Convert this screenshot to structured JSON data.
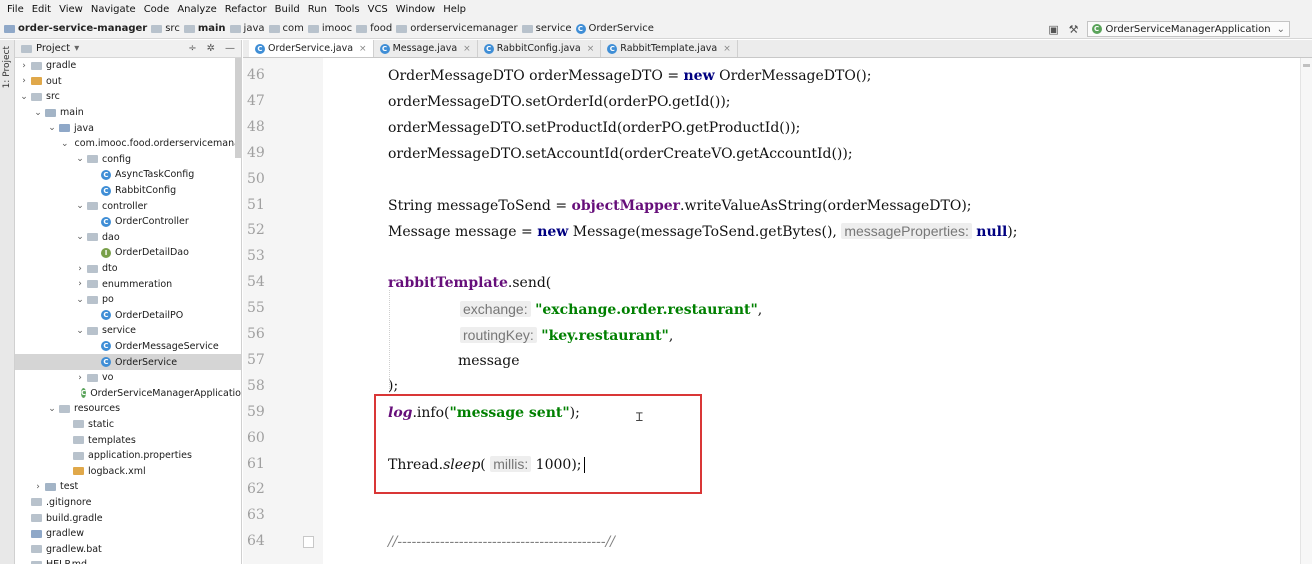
{
  "menu": [
    "File",
    "Edit",
    "View",
    "Navigate",
    "Code",
    "Analyze",
    "Refactor",
    "Build",
    "Run",
    "Tools",
    "VCS",
    "Window",
    "Help"
  ],
  "breadcrumbs": [
    "order-service-manager",
    "src",
    "main",
    "java",
    "com",
    "imooc",
    "food",
    "orderservicemanager",
    "service",
    "OrderService"
  ],
  "run_config": "OrderServiceManagerApplication",
  "tool_stripe_label": "1: Project",
  "project_panel": {
    "title": "Project",
    "tree": [
      {
        "label": "gradle",
        "depth": 0,
        "arrow": ">",
        "icon": "folder"
      },
      {
        "label": "out",
        "depth": 0,
        "arrow": ">",
        "icon": "folder-orange"
      },
      {
        "label": "src",
        "depth": 0,
        "arrow": "v",
        "icon": "folder"
      },
      {
        "label": "main",
        "depth": 1,
        "arrow": "v",
        "icon": "folder-src"
      },
      {
        "label": "java",
        "depth": 2,
        "arrow": "v",
        "icon": "folder-blue"
      },
      {
        "label": "com.imooc.food.orderservicemanag",
        "depth": 3,
        "arrow": "v",
        "icon": "folder"
      },
      {
        "label": "config",
        "depth": 4,
        "arrow": "v",
        "icon": "folder"
      },
      {
        "label": "AsyncTaskConfig",
        "depth": 5,
        "arrow": "",
        "icon": "class"
      },
      {
        "label": "RabbitConfig",
        "depth": 5,
        "arrow": "",
        "icon": "class"
      },
      {
        "label": "controller",
        "depth": 4,
        "arrow": "v",
        "icon": "folder"
      },
      {
        "label": "OrderController",
        "depth": 5,
        "arrow": "",
        "icon": "class"
      },
      {
        "label": "dao",
        "depth": 4,
        "arrow": "v",
        "icon": "folder"
      },
      {
        "label": "OrderDetailDao",
        "depth": 5,
        "arrow": "",
        "icon": "interface"
      },
      {
        "label": "dto",
        "depth": 4,
        "arrow": ">",
        "icon": "folder"
      },
      {
        "label": "enummeration",
        "depth": 4,
        "arrow": ">",
        "icon": "folder"
      },
      {
        "label": "po",
        "depth": 4,
        "arrow": "v",
        "icon": "folder"
      },
      {
        "label": "OrderDetailPO",
        "depth": 5,
        "arrow": "",
        "icon": "class"
      },
      {
        "label": "service",
        "depth": 4,
        "arrow": "v",
        "icon": "folder"
      },
      {
        "label": "OrderMessageService",
        "depth": 5,
        "arrow": "",
        "icon": "class"
      },
      {
        "label": "OrderService",
        "depth": 5,
        "arrow": "",
        "icon": "class",
        "selected": true
      },
      {
        "label": "vo",
        "depth": 4,
        "arrow": ">",
        "icon": "folder"
      },
      {
        "label": "OrderServiceManagerApplicatio",
        "depth": 4,
        "arrow": "",
        "icon": "class-app"
      },
      {
        "label": "resources",
        "depth": 2,
        "arrow": "v",
        "icon": "folder-res"
      },
      {
        "label": "static",
        "depth": 3,
        "arrow": "",
        "icon": "folder"
      },
      {
        "label": "templates",
        "depth": 3,
        "arrow": "",
        "icon": "folder"
      },
      {
        "label": "application.properties",
        "depth": 3,
        "arrow": "",
        "icon": "props"
      },
      {
        "label": "logback.xml",
        "depth": 3,
        "arrow": "",
        "icon": "xml"
      },
      {
        "label": "test",
        "depth": 1,
        "arrow": ">",
        "icon": "folder-src"
      },
      {
        "label": ".gitignore",
        "depth": 0,
        "arrow": "",
        "icon": "file"
      },
      {
        "label": "build.gradle",
        "depth": 0,
        "arrow": "",
        "icon": "gradle"
      },
      {
        "label": "gradlew",
        "depth": 0,
        "arrow": "",
        "icon": "file-blue"
      },
      {
        "label": "gradlew.bat",
        "depth": 0,
        "arrow": "",
        "icon": "file"
      },
      {
        "label": "HELP.md",
        "depth": 0,
        "arrow": "",
        "icon": "file"
      }
    ]
  },
  "tabs": [
    {
      "label": "OrderService.java",
      "active": true
    },
    {
      "label": "Message.java",
      "active": false
    },
    {
      "label": "RabbitConfig.java",
      "active": false
    },
    {
      "label": "RabbitTemplate.java",
      "active": false
    }
  ],
  "line_numbers": [
    "46",
    "47",
    "48",
    "49",
    "50",
    "51",
    "52",
    "53",
    "54",
    "55",
    "56",
    "57",
    "58",
    "59",
    "60",
    "61",
    "62",
    "63",
    "64"
  ],
  "code": {
    "l46": {
      "a": "OrderMessageDTO orderMessageDTO = ",
      "kw": "new",
      "b": " OrderMessageDTO();"
    },
    "l47": "orderMessageDTO.setOrderId(orderPO.getId());",
    "l48": "orderMessageDTO.setProductId(orderPO.getProductId());",
    "l49": "orderMessageDTO.setAccountId(orderCreateVO.getAccountId());",
    "l51": {
      "a": "String messageToSend = ",
      "fld": "objectMapper",
      "b": ".writeValueAsString(orderMessageDTO);"
    },
    "l52": {
      "a": "Message message = ",
      "kw": "new",
      "b": " Message(messageToSend.getBytes(), ",
      "hint": "messageProperties:",
      "kw2": "null",
      "c": ");"
    },
    "l54": {
      "fld": "rabbitTemplate",
      "b": ".send("
    },
    "l55": {
      "hint": "exchange:",
      "str": "\"exchange.order.restaurant\"",
      "c": ","
    },
    "l56": {
      "hint": "routingKey:",
      "str": "\"key.restaurant\"",
      "c": ","
    },
    "l57": "message",
    "l58": ");",
    "l59": {
      "it": "log",
      "b": ".info(",
      "str": "\"message sent\"",
      "c": ");"
    },
    "l61": {
      "a": "Thread.",
      "it": "sleep",
      "b": "( ",
      "hint": "millis:",
      "num": "1000",
      "c": ");"
    },
    "l64": "//--------------------------------------------//"
  },
  "colors": {
    "keyword": "#000080",
    "field": "#660e7a",
    "string": "#008000",
    "highlight_box": "#d93636"
  }
}
